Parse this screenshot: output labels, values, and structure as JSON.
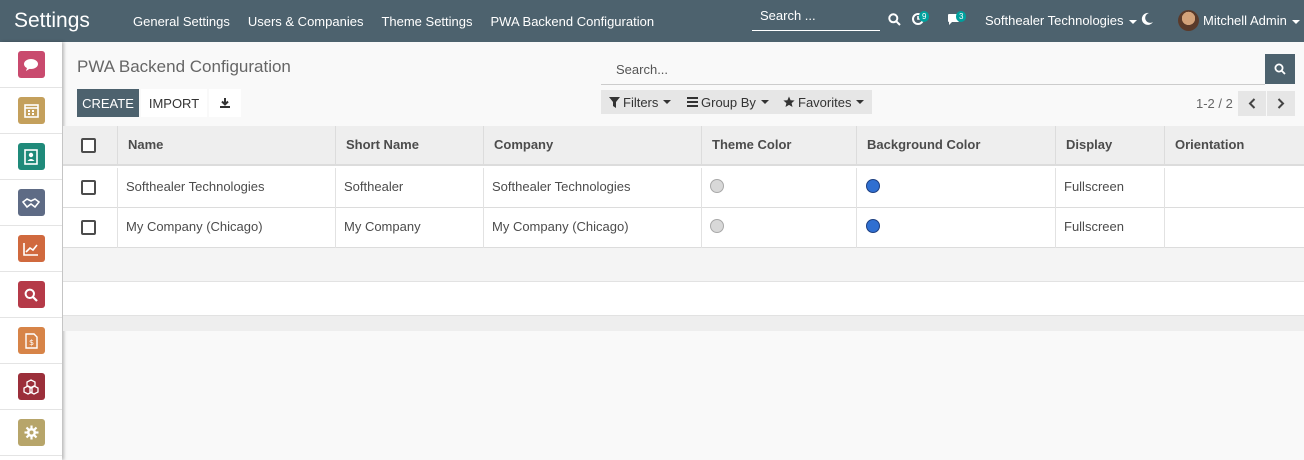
{
  "navbar": {
    "brand": "Settings",
    "menu": [
      "General Settings",
      "Users & Companies",
      "Theme Settings",
      "PWA Backend Configuration"
    ],
    "search_placeholder": "Search ...",
    "activity_count": "9",
    "message_count": "3",
    "company": "Softhealer Technologies",
    "user": "Mitchell Admin"
  },
  "sidebar": {
    "apps": [
      {
        "icon": "discuss-icon",
        "color": "#c94a6e"
      },
      {
        "icon": "calendar-icon",
        "color": "#c4a05c"
      },
      {
        "icon": "contacts-icon",
        "color": "#1f8a7a"
      },
      {
        "icon": "crm-icon",
        "color": "#5e6b85"
      },
      {
        "icon": "sales-icon",
        "color": "#d0693e"
      },
      {
        "icon": "search-app-icon",
        "color": "#b53a48"
      },
      {
        "icon": "invoicing-icon",
        "color": "#d78448"
      },
      {
        "icon": "apps-icon",
        "color": "#9b2f3a"
      },
      {
        "icon": "settings-icon",
        "color": "#b7a56a"
      }
    ]
  },
  "control": {
    "title": "PWA Backend Configuration",
    "create": "CREATE",
    "import": "IMPORT",
    "search_placeholder": "Search...",
    "filters": "Filters",
    "group_by": "Group By",
    "favorites": "Favorites",
    "pager": "1-2 / 2"
  },
  "table": {
    "columns": [
      "Name",
      "Short Name",
      "Company",
      "Theme Color",
      "Background Color",
      "Display",
      "Orientation"
    ],
    "rows": [
      {
        "name": "Softhealer Technologies",
        "short_name": "Softhealer",
        "company": "Softhealer Technologies",
        "theme_color": "#d8d8d8",
        "background_color": "#2f6fd1",
        "display": "Fullscreen",
        "orientation": ""
      },
      {
        "name": "My Company (Chicago)",
        "short_name": "My Company",
        "company": "My Company (Chicago)",
        "theme_color": "#d8d8d8",
        "background_color": "#2f6fd1",
        "display": "Fullscreen",
        "orientation": ""
      }
    ]
  }
}
